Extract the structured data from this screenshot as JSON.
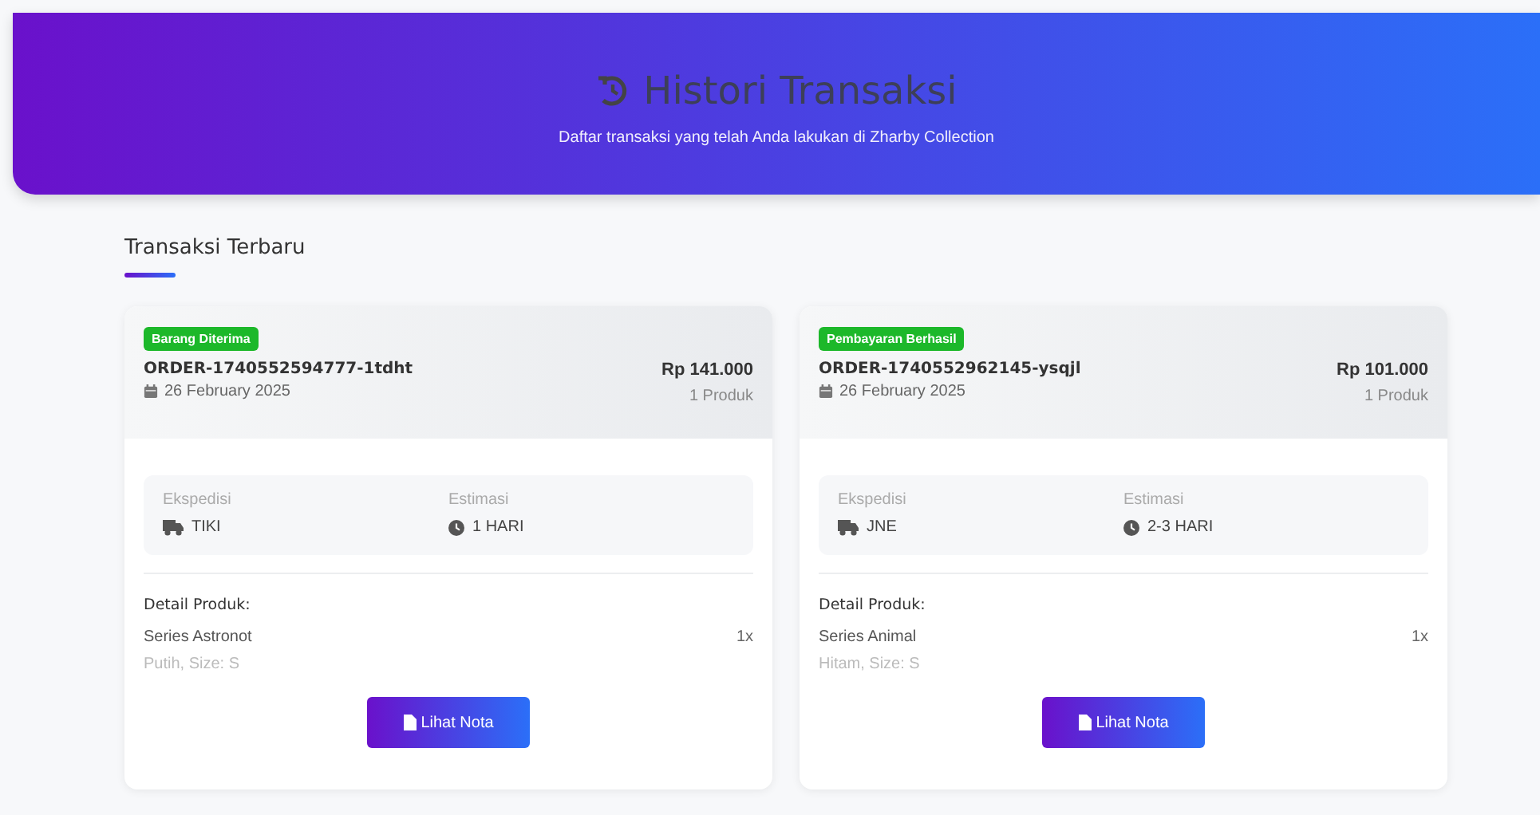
{
  "header": {
    "title": "Histori Transaksi",
    "subtitle": "Daftar transaksi yang telah Anda lakukan di Zharby Collection"
  },
  "section_title": "Transaksi Terbaru",
  "orders": [
    {
      "status": "Barang Diterima",
      "order_id": "ORDER-1740552594777-1tdht",
      "date": "26 February 2025",
      "total": "Rp 141.000",
      "count": "1 Produk",
      "courier_label": "Ekspedisi",
      "courier": "TIKI",
      "estimate_label": "Estimasi",
      "estimate": "1 HARI",
      "detail_title": "Detail Produk:",
      "items": [
        {
          "name": "Series Astronot",
          "variant": "Putih, Size: S",
          "qty": "1x"
        }
      ],
      "button": "Lihat Nota"
    },
    {
      "status": "Pembayaran Berhasil",
      "order_id": "ORDER-1740552962145-ysqjl",
      "date": "26 February 2025",
      "total": "Rp 101.000",
      "count": "1 Produk",
      "courier_label": "Ekspedisi",
      "courier": "JNE",
      "estimate_label": "Estimasi",
      "estimate": "2-3 HARI",
      "detail_title": "Detail Produk:",
      "items": [
        {
          "name": "Series Animal",
          "variant": "Hitam, Size: S",
          "qty": "1x"
        }
      ],
      "button": "Lihat Nota"
    }
  ]
}
